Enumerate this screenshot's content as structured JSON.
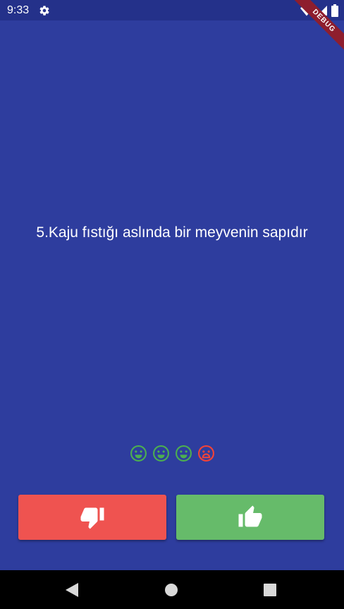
{
  "status_bar": {
    "time": "9:33",
    "icons": [
      "settings-gear-icon",
      "wifi-icon",
      "signal-icon",
      "battery-icon"
    ]
  },
  "debug_banner": {
    "label": "DEBUG"
  },
  "question": {
    "text": "5.Kaju fıstığı aslında bir meyvenin sapıdır"
  },
  "score_keeper": [
    {
      "icon": "happy-face-icon",
      "result": "correct",
      "color": "#4CAF50"
    },
    {
      "icon": "happy-face-icon",
      "result": "correct",
      "color": "#4CAF50"
    },
    {
      "icon": "happy-face-icon",
      "result": "correct",
      "color": "#4CAF50"
    },
    {
      "icon": "sad-face-icon",
      "result": "wrong",
      "color": "#F44336"
    }
  ],
  "buttons": {
    "false_button": {
      "icon": "thumb-down-icon",
      "color": "#EF5350"
    },
    "true_button": {
      "icon": "thumb-up-icon",
      "color": "#66BB6A"
    }
  },
  "nav_bar": {
    "buttons": [
      "back-icon",
      "home-icon",
      "recents-icon"
    ]
  },
  "colors": {
    "background": "#2E3D9E",
    "status_bar": "#24318A"
  }
}
